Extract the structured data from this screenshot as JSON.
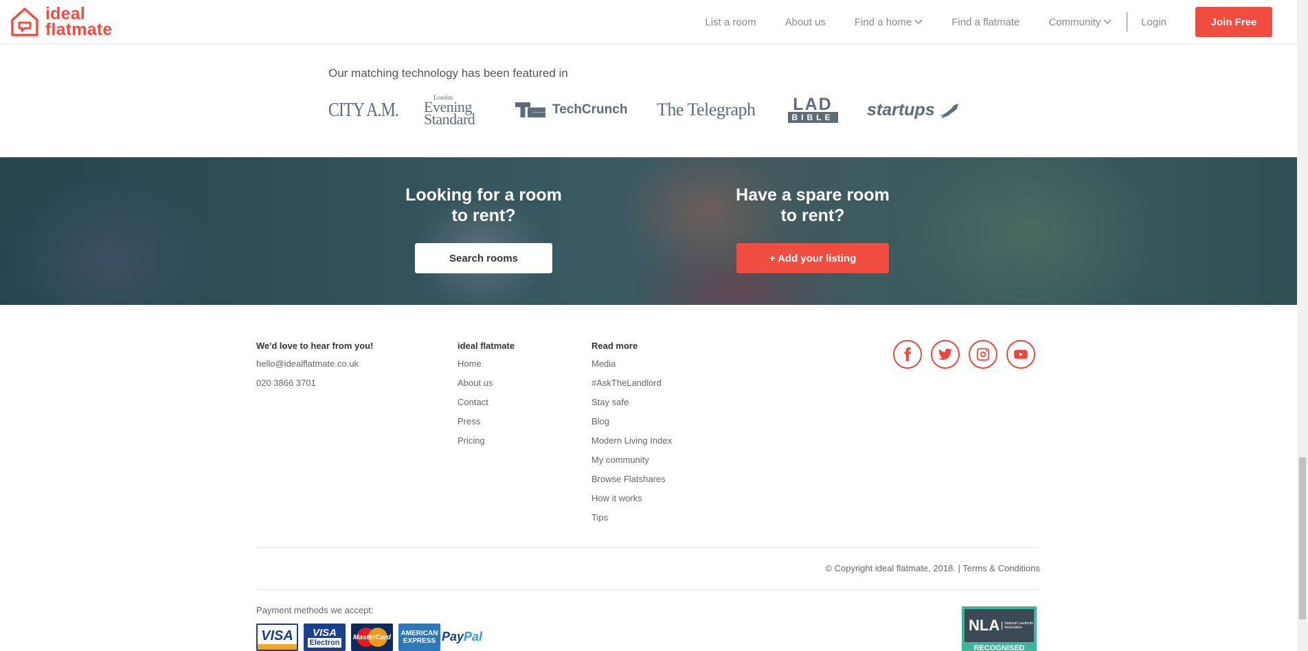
{
  "header": {
    "logo_line1": "ideal",
    "logo_line2": "flatmate",
    "nav": {
      "list_room": "List a room",
      "about": "About us",
      "find_home": "Find a home",
      "find_flatmate": "Find a flatmate",
      "community": "Community",
      "login": "Login",
      "join": "Join Free"
    }
  },
  "featured": {
    "title": "Our matching technology has been featured in",
    "logos": {
      "cityam": "CITY A.M.",
      "evening_small": "London",
      "evening_line1": "Evening",
      "evening_line2": "Standard",
      "techcrunch": "TechCrunch",
      "telegraph": "The Telegraph",
      "lad": "LAD",
      "bible": "BIBLE",
      "startups": "startups"
    }
  },
  "hero": {
    "left_heading": "Looking for a room to rent?",
    "left_button": "Search rooms",
    "right_heading": "Have a spare room to rent?",
    "right_button": "+ Add your listing"
  },
  "footer": {
    "contact": {
      "heading": "We'd love to hear from you!",
      "email": "hello@idealflatmate.co.uk",
      "phone": "020 3866 3701"
    },
    "brand": {
      "heading": "ideal flatmate",
      "links": [
        "Home",
        "About us",
        "Contact",
        "Press",
        "Pricing"
      ]
    },
    "read_more": {
      "heading": "Read more",
      "links": [
        "Media",
        "#AskTheLandlord",
        "Stay safe",
        "Blog",
        "Modern Living Index",
        "My community",
        "Browse Flatshares",
        "How it works",
        "Tips"
      ]
    },
    "socials": [
      "facebook-icon",
      "twitter-icon",
      "instagram-icon",
      "youtube-icon"
    ],
    "copyright": "© Copyright ideal flatmate, 2018. | Terms & Conditions",
    "payment_title": "Payment methods we accept:",
    "cards": {
      "visa": "VISA",
      "electron_v": "VISA",
      "electron_e": "Electron",
      "mastercard": "MasterCard",
      "amex_1": "AMERICAN",
      "amex_2": "EXPRESS",
      "paypal_1": "Pay",
      "paypal_2": "Pal"
    },
    "nla": {
      "big": "NLA",
      "small": "National Landlords Association",
      "recognised": "RECOGNISED"
    }
  },
  "colors": {
    "brand": "#f04d40",
    "nav_text": "#8a8a8a",
    "press_logo": "#5e6c7a"
  }
}
